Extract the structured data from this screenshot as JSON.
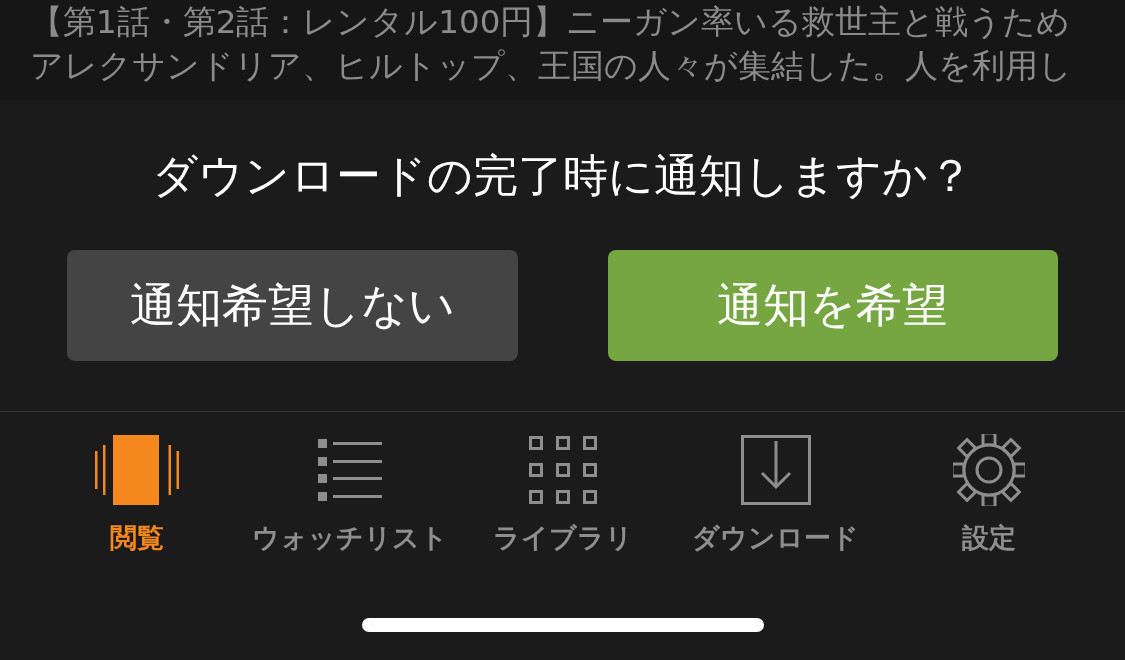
{
  "description": {
    "lines": [
      "【第1話・第2話：レンタル100円】ニーガン率いる救世主と戦うため",
      "アレクサンドリア、ヒルトップ、王国の人々が集結した。人を利用し"
    ]
  },
  "dialog": {
    "question": "ダウンロードの完了時に通知しますか？",
    "buttons": [
      {
        "label": "通知希望しない",
        "kind": "secondary"
      },
      {
        "label": "通知を希望",
        "kind": "primary"
      }
    ]
  },
  "tab_bar": [
    {
      "label": "閲覧",
      "kind": "browse",
      "selected": true
    },
    {
      "label": "ウォッチリスト",
      "kind": "list",
      "selected": false
    },
    {
      "label": "ライブラリ",
      "kind": "grid",
      "selected": false
    },
    {
      "label": "ダウンロード",
      "kind": "download",
      "selected": false
    },
    {
      "label": "設定",
      "kind": "settings",
      "selected": false
    }
  ]
}
